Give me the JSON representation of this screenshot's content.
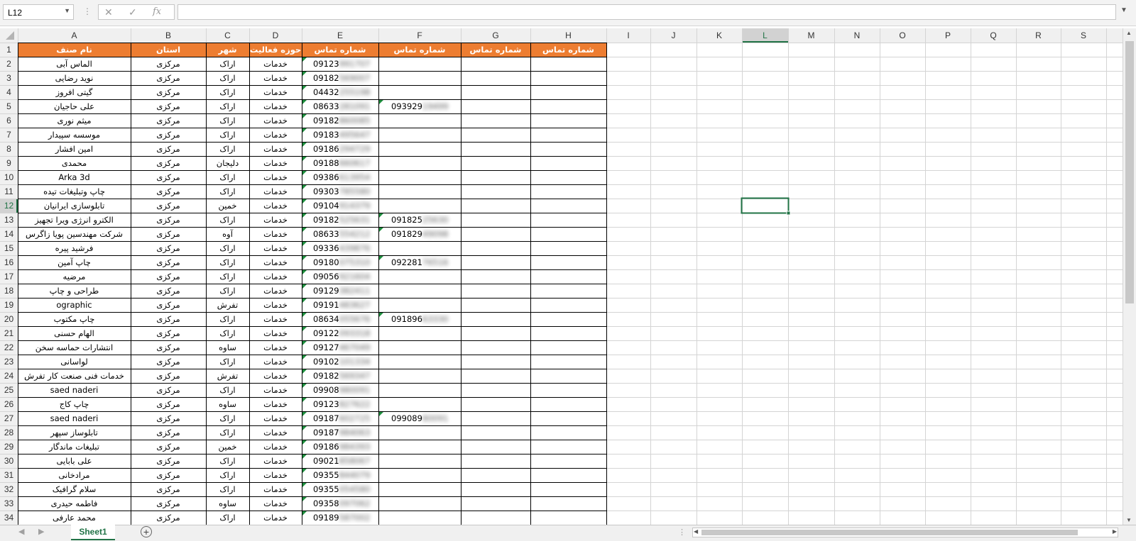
{
  "formula_bar": {
    "name_box": "L12",
    "cancel_icon": "✕",
    "enter_icon": "✓",
    "fx_label": "fx",
    "formula": ""
  },
  "columns": [
    "A",
    "B",
    "C",
    "D",
    "E",
    "F",
    "G",
    "H",
    "I",
    "J",
    "K",
    "L",
    "M",
    "N",
    "O",
    "P",
    "Q",
    "R",
    "S"
  ],
  "selected_cell": "L12",
  "header_row": [
    "نام صنف",
    "استان",
    "شهر",
    "حوزه فعالیت",
    "شماره تماس",
    "شماره تماس",
    "شماره تماس",
    "شماره تماس"
  ],
  "rows": [
    {
      "name": "الماس آبی",
      "province": "مرکزی",
      "city": "اراک",
      "field": "خدمات",
      "phone1": "09123991707",
      "phone2": ""
    },
    {
      "name": "نوید رضایی",
      "province": "مرکزی",
      "city": "اراک",
      "field": "خدمات",
      "phone1": "09182569007",
      "phone2": ""
    },
    {
      "name": "گیتی افروز",
      "province": "مرکزی",
      "city": "اراک",
      "field": "خدمات",
      "phone1": "04432255198",
      "phone2": ""
    },
    {
      "name": "علی حاجیان",
      "province": "مرکزی",
      "city": "اراک",
      "field": "خدمات",
      "phone1": "08633281091",
      "phone2": "09392919499"
    },
    {
      "name": "میثم نوری",
      "province": "مرکزی",
      "city": "اراک",
      "field": "خدمات",
      "phone1": "09182860085",
      "phone2": ""
    },
    {
      "name": "موسسه سپیدار",
      "province": "مرکزی",
      "city": "اراک",
      "field": "خدمات",
      "phone1": "09183495647",
      "phone2": ""
    },
    {
      "name": "امین افشار",
      "province": "مرکزی",
      "city": "اراک",
      "field": "خدمات",
      "phone1": "09186294729",
      "phone2": ""
    },
    {
      "name": "محمدی",
      "province": "مرکزی",
      "city": "دلیجان",
      "field": "خدمات",
      "phone1": "09188660617",
      "phone2": ""
    },
    {
      "name": "Arka 3d",
      "province": "مرکزی",
      "city": "اراک",
      "field": "خدمات",
      "phone1": "09386613954",
      "phone2": ""
    },
    {
      "name": "چاپ وتبلیغات تیده",
      "province": "مرکزی",
      "city": "اراک",
      "field": "خدمات",
      "phone1": "09303785580",
      "phone2": ""
    },
    {
      "name": "تابلوسازی ایرانیان",
      "province": "مرکزی",
      "city": "خمین",
      "field": "خدمات",
      "phone1": "09104914379",
      "phone2": ""
    },
    {
      "name": "الکترو انرژی ویرا تجهیز",
      "province": "مرکزی",
      "city": "اراک",
      "field": "خدمات",
      "phone1": "09182525631",
      "phone2": "09182525630"
    },
    {
      "name": "شرکت مهندسین پویا زاگرس",
      "province": "مرکزی",
      "city": "آوه",
      "field": "خدمات",
      "phone1": "08633554212",
      "phone2": "09182949098"
    },
    {
      "name": "فرشید پیره",
      "province": "مرکزی",
      "city": "اراک",
      "field": "خدمات",
      "phone1": "09336439876",
      "phone2": ""
    },
    {
      "name": "چاپ آمین",
      "province": "مرکزی",
      "city": "اراک",
      "field": "خدمات",
      "phone1": "09180075310",
      "phone2": "09228176516"
    },
    {
      "name": "مرضیه",
      "province": "مرکزی",
      "city": "اراک",
      "field": "خدمات",
      "phone1": "09056921604",
      "phone2": ""
    },
    {
      "name": "طراحی و چاپ",
      "province": "مرکزی",
      "city": "اراک",
      "field": "خدمات",
      "phone1": "09129382411",
      "phone2": ""
    },
    {
      "name": "ographic",
      "province": "مرکزی",
      "city": "تفرش",
      "field": "خدمات",
      "phone1": "09191483627",
      "phone2": ""
    },
    {
      "name": "چاپ مکتوب",
      "province": "مرکزی",
      "city": "اراک",
      "field": "خدمات",
      "phone1": "08634055676",
      "phone2": "09189663330"
    },
    {
      "name": "الهام حسنی",
      "province": "مرکزی",
      "city": "اراک",
      "field": "خدمات",
      "phone1": "09122093318",
      "phone2": ""
    },
    {
      "name": "انتشارات حماسه سخن",
      "province": "مرکزی",
      "city": "ساوه",
      "field": "خدمات",
      "phone1": "09127467049",
      "phone2": ""
    },
    {
      "name": "لواسانی",
      "province": "مرکزی",
      "city": "اراک",
      "field": "خدمات",
      "phone1": "09102101334",
      "phone2": ""
    },
    {
      "name": "خدمات فنی صنعت کار تفرش",
      "province": "مرکزی",
      "city": "تفرش",
      "field": "خدمات",
      "phone1": "09182569347",
      "phone2": ""
    },
    {
      "name": "saed naderi",
      "province": "مرکزی",
      "city": "اراک",
      "field": "خدمات",
      "phone1": "09908980091",
      "phone2": ""
    },
    {
      "name": "چاپ کاج",
      "province": "مرکزی",
      "city": "ساوه",
      "field": "خدمات",
      "phone1": "09123827622",
      "phone2": ""
    },
    {
      "name": "saed naderi",
      "province": "مرکزی",
      "city": "اراک",
      "field": "خدمات",
      "phone1": "09187602725",
      "phone2": "09908980091"
    },
    {
      "name": "تابلوساز سپهر",
      "province": "مرکزی",
      "city": "اراک",
      "field": "خدمات",
      "phone1": "09187984063",
      "phone2": ""
    },
    {
      "name": "تبلیغات ماندگار",
      "province": "مرکزی",
      "city": "خمین",
      "field": "خدمات",
      "phone1": "09186984393",
      "phone2": ""
    },
    {
      "name": "علی بابایی",
      "province": "مرکزی",
      "city": "اراک",
      "field": "خدمات",
      "phone1": "09021858067",
      "phone2": ""
    },
    {
      "name": "مرادخانی",
      "province": "مرکزی",
      "city": "اراک",
      "field": "خدمات",
      "phone1": "09355844079",
      "phone2": ""
    },
    {
      "name": "سلام گرافیک",
      "province": "مرکزی",
      "city": "اراک",
      "field": "خدمات",
      "phone1": "09355054580",
      "phone2": ""
    },
    {
      "name": "فاطمه حیدری",
      "province": "مرکزی",
      "city": "ساوه",
      "field": "خدمات",
      "phone1": "09358097062",
      "phone2": ""
    },
    {
      "name": "محمد عارفی",
      "province": "مرکزی",
      "city": "اراک",
      "field": "خدمات",
      "phone1": "09189587002",
      "phone2": ""
    }
  ],
  "sheet_tab": "Sheet1",
  "colors": {
    "header_fill": "#ED7D31",
    "header_text": "#ffffff",
    "gridline": "#d4d4d4",
    "selection": "#217346",
    "error_triangle": "#1e8f3e"
  }
}
